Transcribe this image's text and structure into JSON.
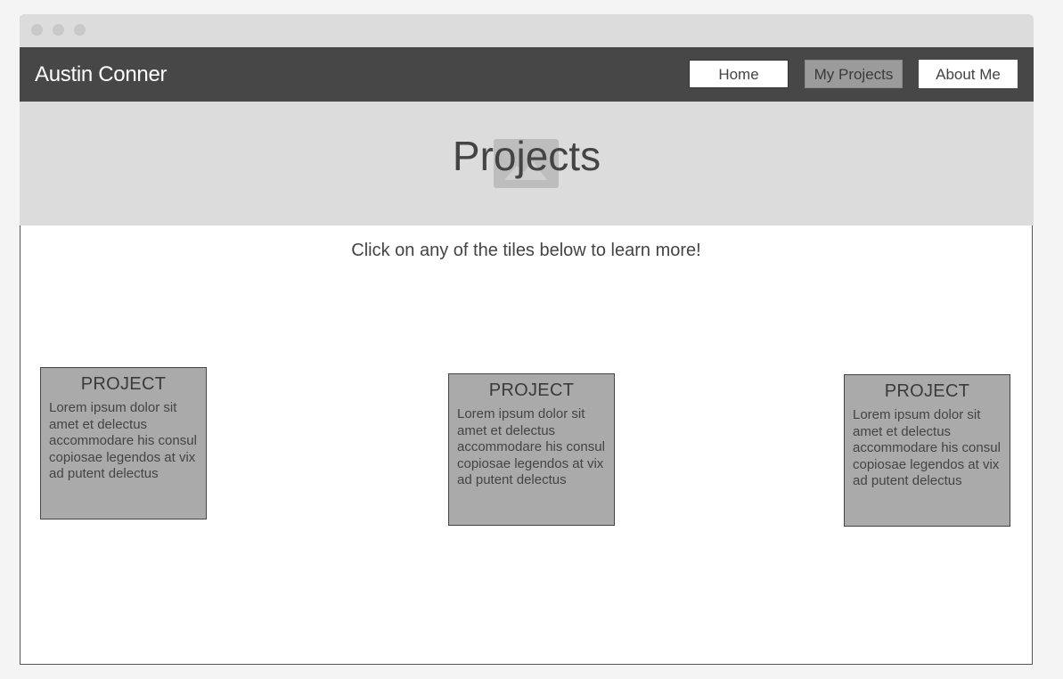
{
  "window": {
    "controls": [
      "close",
      "minimize",
      "maximize"
    ]
  },
  "navbar": {
    "brand": "Austin Conner",
    "links": [
      {
        "label": "Home"
      },
      {
        "label": "My Projects",
        "active": true
      },
      {
        "label": "About Me"
      }
    ]
  },
  "hero": {
    "title": "Projects",
    "image_icon": "image-placeholder-icon"
  },
  "main": {
    "subtitle": "Click on any of the tiles below to learn more!",
    "tiles": [
      {
        "title": "PROJECT",
        "body": "Lorem ipsum dolor sit amet et delectus accommodare his consul copiosae legendos at vix ad putent delectus"
      },
      {
        "title": "PROJECT",
        "body": "Lorem ipsum dolor sit amet et delectus accommodare his consul copiosae legendos at vix ad putent delectus"
      },
      {
        "title": "PROJECT",
        "body": "Lorem ipsum dolor sit amet et delectus accommodare his consul copiosae legendos at vix ad putent delectus"
      }
    ]
  },
  "colors": {
    "navbar_bg": "#474747",
    "hero_bg": "#dcdcdc",
    "tile_bg": "#aaaaaa",
    "active_nav_bg": "#9b9b9b"
  }
}
